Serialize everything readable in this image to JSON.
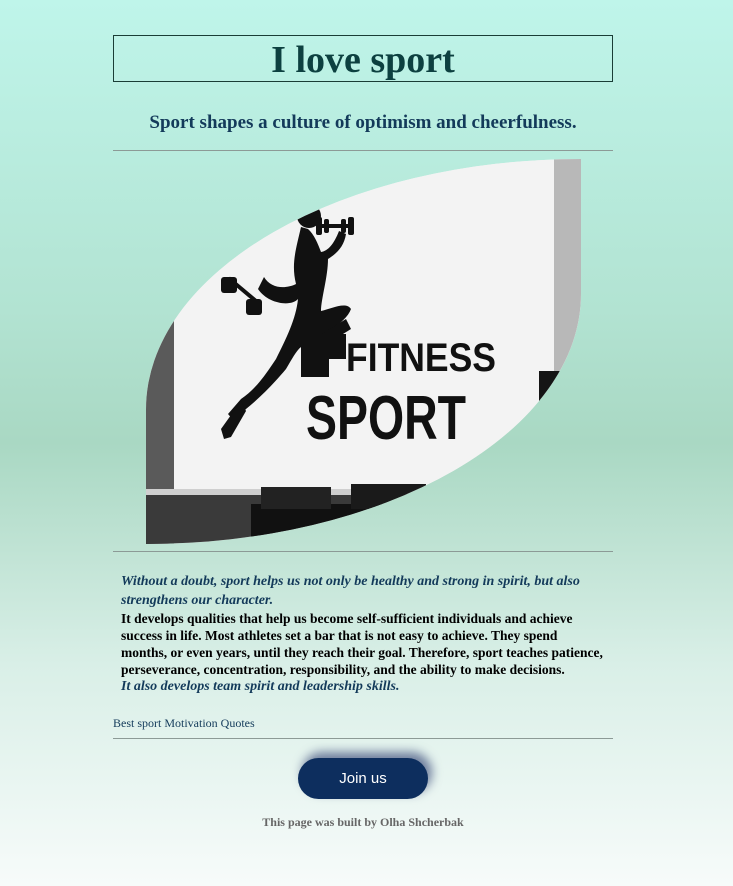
{
  "header": {
    "title": "I love sport",
    "subtitle": "Sport shapes a culture of optimism and cheerfulness."
  },
  "image": {
    "logo_text_line1": "FITNESS",
    "logo_text_line2": "SPORT"
  },
  "content": {
    "quote1": "Without a doubt, sport helps us not only be healthy and strong in spirit, but also strengthens our character.",
    "body": "It develops qualities that help us become self-sufficient individuals and achieve success in life. Most athletes set a bar that is not easy to achieve. They spend months, or even years, until they reach their goal. Therefore, sport teaches patience, perseverance, concentration, responsibility, and the ability to make decisions.",
    "quote2": "It also develops team spirit and leadership skills."
  },
  "link": {
    "label": "Best sport Motivation Quotes"
  },
  "cta": {
    "label": "Join us"
  },
  "footer": {
    "text": "This page was built by Olha Shcherbak"
  },
  "colors": {
    "title": "#0d4040",
    "subtitle": "#133a5a",
    "button": "#0d2e5e"
  }
}
